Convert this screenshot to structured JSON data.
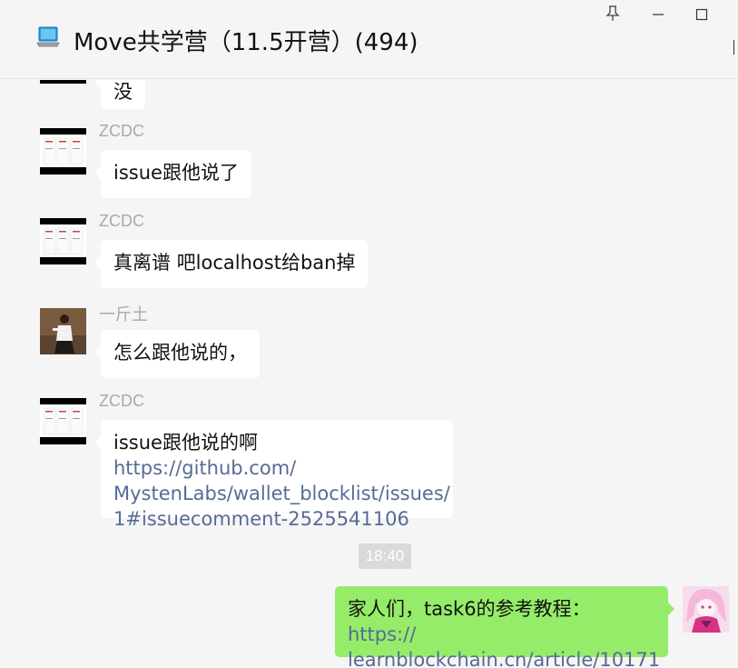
{
  "window": {
    "title": "Move共学营（11.5开营）(494)"
  },
  "icons": {
    "title_icon": "laptop-icon",
    "pin": "pin-icon",
    "minimize": "minimize-icon",
    "maximize": "maximize-icon"
  },
  "colors": {
    "background": "#f5f5f5",
    "bubble_other": "#ffffff",
    "bubble_mine": "#95ec69",
    "link": "#576b95",
    "sender_name": "#a8a8a8"
  },
  "messages": [
    {
      "sender": "",
      "text": "没"
    },
    {
      "sender": "ZCDC",
      "text": "issue跟他说了"
    },
    {
      "sender": "ZCDC",
      "text": "真离谱 吧localhost给ban掉"
    },
    {
      "sender": "一斤土",
      "text": "怎么跟他说的，"
    },
    {
      "sender": "ZCDC",
      "text": "issue跟他说的啊 ",
      "link_line1": "https://github.com/",
      "link_line2": "MystenLabs/wallet_blocklist/issues/",
      "link_line3": "1#issuecomment-2525541106"
    }
  ],
  "timestamp": "18:40",
  "my_message": {
    "text": "家人们，task6的参考教程：",
    "link_part1": "https://",
    "link_part2": "learnblockchain.cn/article/10171"
  }
}
